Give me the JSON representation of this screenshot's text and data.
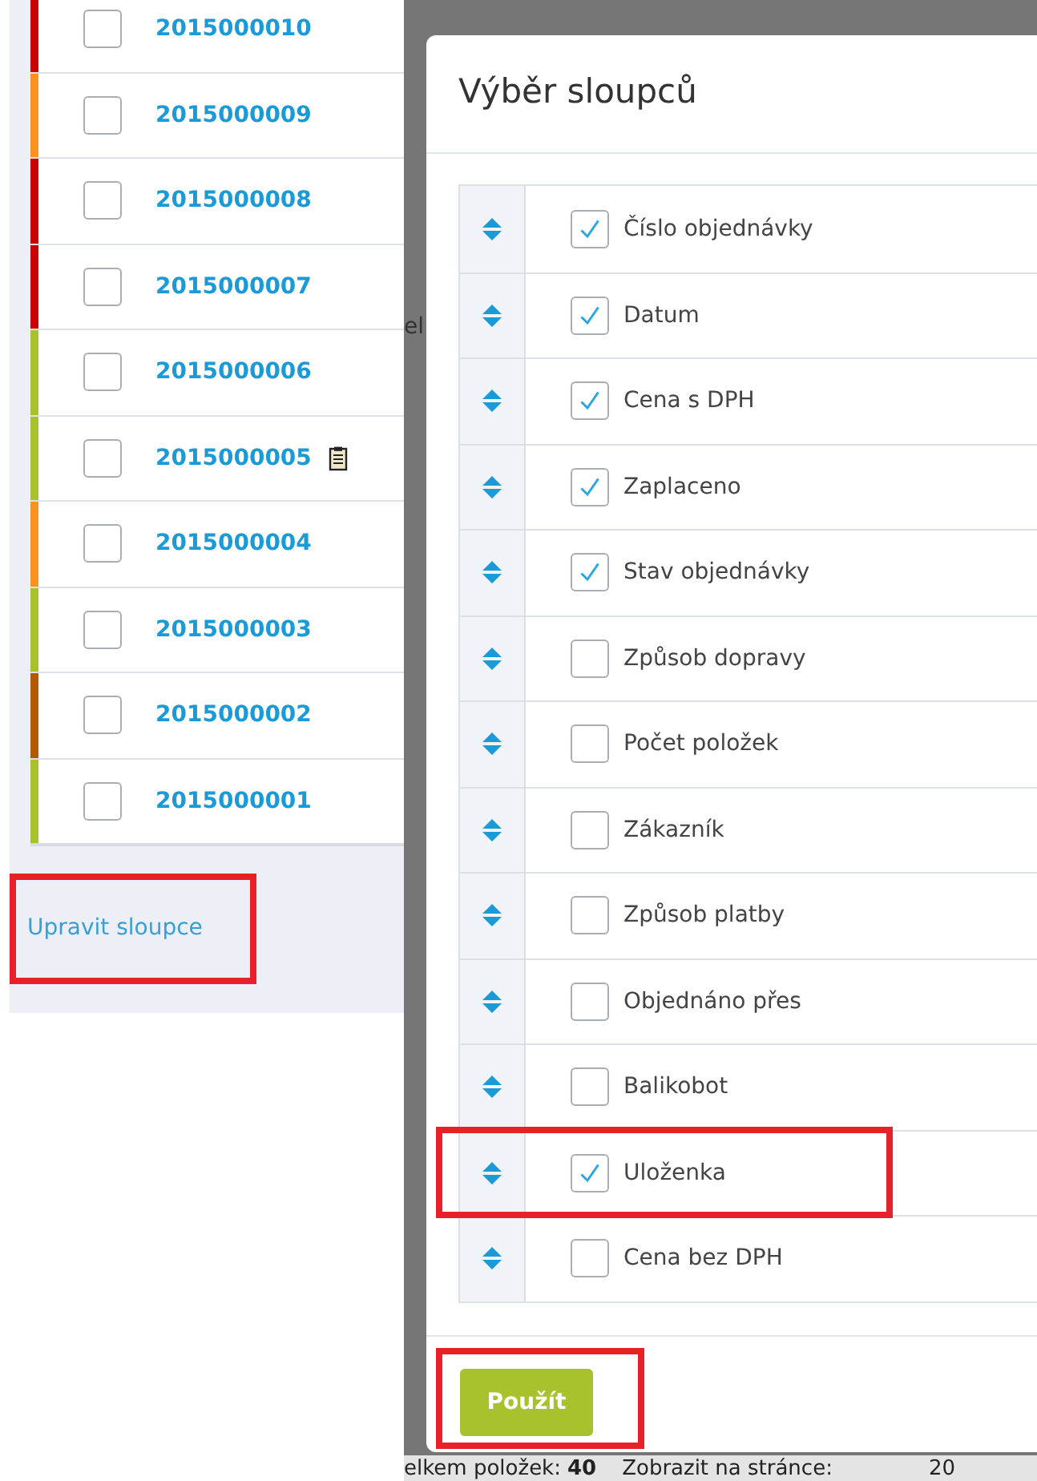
{
  "orders": [
    {
      "number": "2015000010",
      "color": "#cc0000",
      "checked": false,
      "note": false
    },
    {
      "number": "2015000009",
      "color": "#f7931e",
      "checked": false,
      "note": false
    },
    {
      "number": "2015000008",
      "color": "#cc0000",
      "checked": false,
      "note": false
    },
    {
      "number": "2015000007",
      "color": "#cc0000",
      "checked": false,
      "note": false
    },
    {
      "number": "2015000006",
      "color": "#a8c22e",
      "checked": false,
      "note": false
    },
    {
      "number": "2015000005",
      "color": "#a8c22e",
      "checked": false,
      "note": true
    },
    {
      "number": "2015000004",
      "color": "#f7931e",
      "checked": false,
      "note": false
    },
    {
      "number": "2015000003",
      "color": "#a8c22e",
      "checked": false,
      "note": false
    },
    {
      "number": "2015000002",
      "color": "#b35900",
      "checked": false,
      "note": false
    },
    {
      "number": "2015000001",
      "color": "#a8c22e",
      "checked": false,
      "note": false
    }
  ],
  "edit_columns_link": "Upravit sloupce",
  "background_fragment": "el",
  "footer": {
    "total_label": "elkem položek:",
    "total": "40",
    "per_page_label": "Zobrazit na stránce:",
    "per_page": "20"
  },
  "dialog": {
    "title": "Výběr sloupců",
    "columns": [
      {
        "label": "Číslo objednávky",
        "checked": true
      },
      {
        "label": "Datum",
        "checked": true
      },
      {
        "label": "Cena s DPH",
        "checked": true
      },
      {
        "label": "Zaplaceno",
        "checked": true
      },
      {
        "label": "Stav objednávky",
        "checked": true
      },
      {
        "label": "Způsob dopravy",
        "checked": false
      },
      {
        "label": "Počet položek",
        "checked": false
      },
      {
        "label": "Zákazník",
        "checked": false
      },
      {
        "label": "Způsob platby",
        "checked": false
      },
      {
        "label": "Objednáno přes",
        "checked": false
      },
      {
        "label": "Balikobot",
        "checked": false
      },
      {
        "label": "Uloženka",
        "checked": true
      },
      {
        "label": "Cena bez DPH",
        "checked": false
      }
    ],
    "apply_button": "Použít"
  }
}
